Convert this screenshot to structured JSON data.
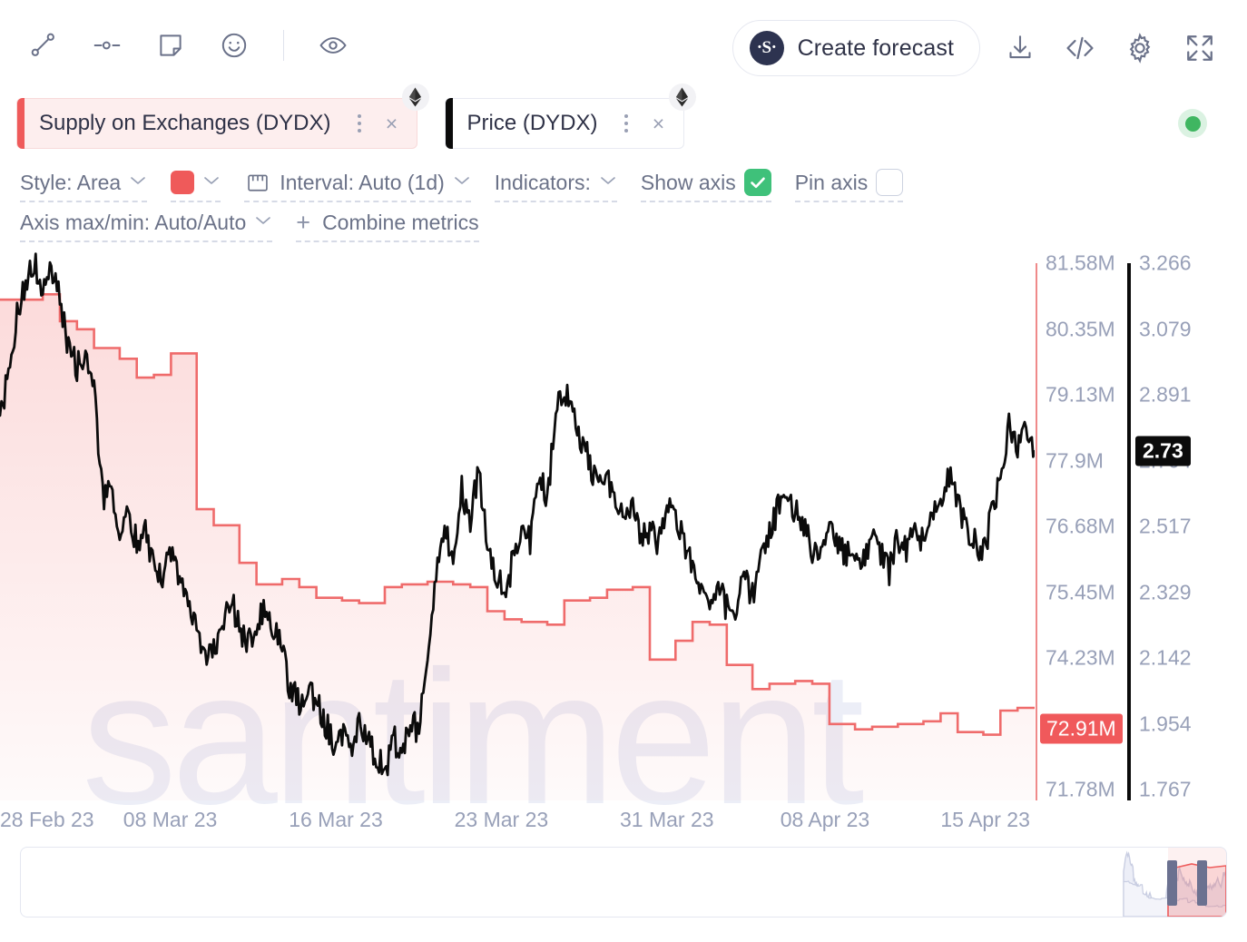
{
  "toolbar": {
    "icons": [
      {
        "name": "trend-line-icon",
        "label": "Trend line"
      },
      {
        "name": "horizontal-line-icon",
        "label": "Horizontal line"
      },
      {
        "name": "note-icon",
        "label": "Note"
      },
      {
        "name": "emoji-icon",
        "label": "Emoji"
      },
      {
        "name": "eye-icon",
        "label": "Watch"
      }
    ],
    "forecast_button": {
      "label": "Create forecast",
      "logo": "·S·"
    },
    "right_icons": [
      {
        "name": "download-icon",
        "label": "Download"
      },
      {
        "name": "embed-code-icon",
        "label": "Embed"
      },
      {
        "name": "gear-icon",
        "label": "Settings"
      },
      {
        "name": "fullscreen-icon",
        "label": "Fullscreen"
      }
    ]
  },
  "chips": [
    {
      "label": "Supply on Exchanges (DYDX)",
      "color": "#ef5a5a",
      "badge": "ethereum-icon",
      "menu": "more-options",
      "close": "×"
    },
    {
      "label": "Price (DYDX)",
      "color": "#0b0b0b",
      "badge": "ethereum-icon",
      "menu": "more-options",
      "close": "×"
    }
  ],
  "status": {
    "name": "live-status-dot",
    "color": "#3fb661"
  },
  "options": {
    "style": {
      "label": "Style: Area",
      "caret": "⌄"
    },
    "color_swatch": {
      "color": "#ef5a5a",
      "caret": "⌄"
    },
    "interval": {
      "label": "Interval: Auto (1d)",
      "icon": "calendar-icon",
      "caret": "⌄"
    },
    "indicators": {
      "label": "Indicators:",
      "caret": "⌄"
    },
    "show_axis": {
      "label": "Show axis",
      "checked": true,
      "check": "✓"
    },
    "pin_axis": {
      "label": "Pin axis",
      "checked": false
    },
    "axis_minmax": {
      "label": "Axis max/min: Auto/Auto",
      "caret": "⌄"
    },
    "combine": {
      "label": "Combine metrics",
      "plus": "+"
    }
  },
  "watermark": "santiment",
  "chart_data": {
    "type": "line",
    "title": "",
    "xlabel": "",
    "grid": false,
    "legend_position": "top",
    "x_tick_labels": [
      "28 Feb 23",
      "08 Mar 23",
      "16 Mar 23",
      "23 Mar 23",
      "31 Mar 23",
      "08 Apr 23",
      "15 Apr 23"
    ],
    "x_tick_positions_pct": [
      5.0,
      17.0,
      33.0,
      49.0,
      65.0,
      80.5,
      96.0
    ],
    "axes": [
      {
        "name": "Supply on Exchanges (DYDX)",
        "side": "right-inner",
        "color": "#ef8a8a",
        "tick_labels": [
          "81.58M",
          "80.35M",
          "79.13M",
          "77.9M",
          "76.68M",
          "75.45M",
          "74.23M",
          "72.91M",
          "71.78M"
        ],
        "tick_values": [
          81580000,
          80350000,
          79130000,
          77900000,
          76680000,
          75450000,
          74230000,
          72910000,
          71780000
        ],
        "ylim": [
          71780000,
          81580000
        ],
        "highlight_label": "72.91M",
        "highlight_color": "#f0595b"
      },
      {
        "name": "Price (DYDX)",
        "side": "right-outer",
        "color": "#0b0b0b",
        "tick_labels": [
          "3.266",
          "3.079",
          "2.891",
          "2.704",
          "2.517",
          "2.329",
          "2.142",
          "1.954",
          "1.767"
        ],
        "tick_values": [
          3.266,
          3.079,
          2.891,
          2.704,
          2.517,
          2.329,
          2.142,
          1.954,
          1.767
        ],
        "ylim": [
          1.767,
          3.266
        ],
        "highlight_label": "2.73",
        "highlight_color": "#0b0b0b"
      }
    ],
    "series": [
      {
        "name": "Supply on Exchanges (DYDX)",
        "type": "area",
        "color": "#ef5a5a",
        "fill": "rgba(239,90,90,0.16)",
        "unit": "M",
        "values": [
          80.9,
          80.9,
          80.9,
          80.9,
          80.9,
          81.0,
          81.0,
          80.5,
          80.5,
          80.35,
          80.35,
          80.0,
          80.0,
          80.0,
          79.8,
          79.8,
          79.45,
          79.45,
          79.5,
          79.5,
          79.9,
          79.9,
          79.9,
          77.0,
          77.0,
          76.7,
          76.7,
          76.7,
          76.0,
          76.0,
          75.6,
          75.6,
          75.6,
          75.7,
          75.7,
          75.55,
          75.55,
          75.35,
          75.35,
          75.35,
          75.3,
          75.3,
          75.25,
          75.25,
          75.25,
          75.55,
          75.55,
          75.6,
          75.6,
          75.6,
          75.65,
          75.65,
          75.65,
          75.6,
          75.6,
          75.55,
          75.55,
          75.1,
          75.1,
          74.95,
          74.95,
          74.9,
          74.9,
          74.9,
          74.85,
          74.85,
          75.3,
          75.3,
          75.3,
          75.35,
          75.35,
          75.5,
          75.5,
          75.5,
          75.55,
          75.55,
          74.2,
          74.2,
          74.2,
          74.55,
          74.55,
          74.9,
          74.9,
          74.85,
          74.85,
          74.1,
          74.1,
          74.1,
          73.65,
          73.65,
          73.75,
          73.75,
          73.75,
          73.8,
          73.8,
          73.75,
          73.75,
          73.0,
          73.0,
          73.0,
          72.9,
          72.9,
          72.95,
          72.95,
          72.95,
          73.0,
          73.0,
          73.0,
          73.05,
          73.05,
          73.2,
          73.2,
          72.85,
          72.85,
          72.85,
          72.8,
          72.8,
          73.25,
          73.25,
          73.3,
          73.3,
          73.3
        ]
      },
      {
        "name": "Price (DYDX)",
        "type": "line",
        "color": "#0b0b0b",
        "unit": "USD",
        "values": [
          2.82,
          2.95,
          3.12,
          3.21,
          3.27,
          3.19,
          3.25,
          3.16,
          3.02,
          2.97,
          2.99,
          2.93,
          2.6,
          2.63,
          2.52,
          2.55,
          2.47,
          2.5,
          2.41,
          2.38,
          2.43,
          2.35,
          2.31,
          2.22,
          2.14,
          2.17,
          2.25,
          2.31,
          2.22,
          2.18,
          2.24,
          2.3,
          2.23,
          2.16,
          2.05,
          2.02,
          2.06,
          2.01,
          1.96,
          1.9,
          1.93,
          1.87,
          1.95,
          1.92,
          1.86,
          1.82,
          1.91,
          1.88,
          1.96,
          1.93,
          2.16,
          2.38,
          2.5,
          2.45,
          2.62,
          2.52,
          2.69,
          2.46,
          2.39,
          2.31,
          2.42,
          2.51,
          2.47,
          2.66,
          2.59,
          2.85,
          2.91,
          2.83,
          2.76,
          2.7,
          2.62,
          2.66,
          2.59,
          2.52,
          2.56,
          2.48,
          2.51,
          2.45,
          2.6,
          2.55,
          2.47,
          2.4,
          2.33,
          2.3,
          2.36,
          2.28,
          2.24,
          2.38,
          2.32,
          2.44,
          2.5,
          2.57,
          2.62,
          2.56,
          2.51,
          2.45,
          2.47,
          2.53,
          2.48,
          2.43,
          2.46,
          2.41,
          2.5,
          2.44,
          2.39,
          2.48,
          2.44,
          2.52,
          2.47,
          2.55,
          2.6,
          2.66,
          2.58,
          2.52,
          2.47,
          2.44,
          2.55,
          2.67,
          2.8,
          2.73,
          2.79,
          2.73
        ]
      }
    ]
  },
  "navigator": {
    "name": "range-navigator",
    "left_handle": "nav-handle-left",
    "right_handle": "nav-handle-right"
  }
}
